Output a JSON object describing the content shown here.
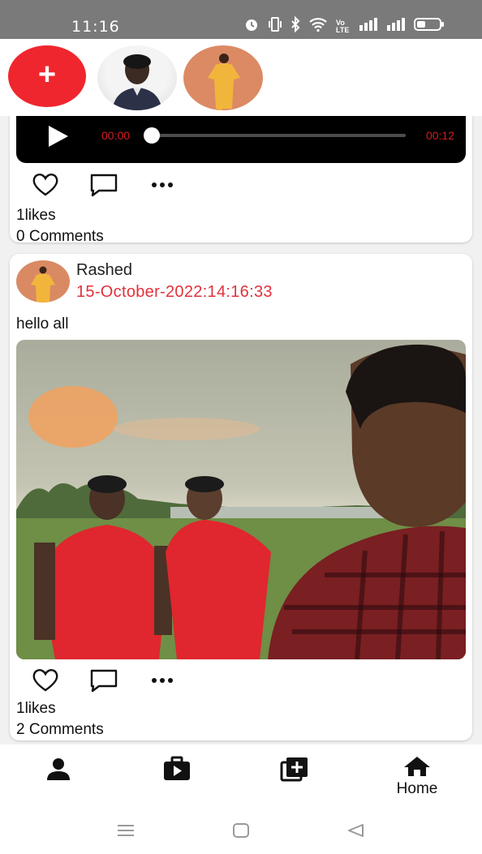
{
  "status_bar": {
    "time": "11:16",
    "icons": [
      "alarm-icon",
      "vibrate-icon",
      "bluetooth-icon",
      "wifi-icon",
      "volte-icon",
      "signal-icon",
      "signal-icon",
      "battery-icon"
    ],
    "volte_label": "Vo LTE"
  },
  "stories": {
    "add_label": "+",
    "items": [
      {
        "name": "story-avatar-1"
      },
      {
        "name": "story-avatar-2"
      }
    ]
  },
  "posts": [
    {
      "type": "audio",
      "audio": {
        "current_time": "00:00",
        "duration": "00:12",
        "progress": 0
      },
      "likes": "1likes",
      "comments": "0 Comments"
    },
    {
      "type": "photo",
      "author": "Rashed",
      "date": "15-October-2022:14:16:33",
      "caption": "hello all",
      "likes": "1likes",
      "comments": "2 Comments"
    }
  ],
  "bottom_nav": {
    "items": [
      {
        "icon": "person-icon",
        "label": ""
      },
      {
        "icon": "video-icon",
        "label": ""
      },
      {
        "icon": "add-media-icon",
        "label": ""
      },
      {
        "icon": "home-icon",
        "label": "Home"
      }
    ]
  },
  "colors": {
    "accent": "#f0262e",
    "date_red": "#e0323c",
    "audio_time_red": "#d51c1c",
    "status_bar": "#7a7a7a"
  }
}
